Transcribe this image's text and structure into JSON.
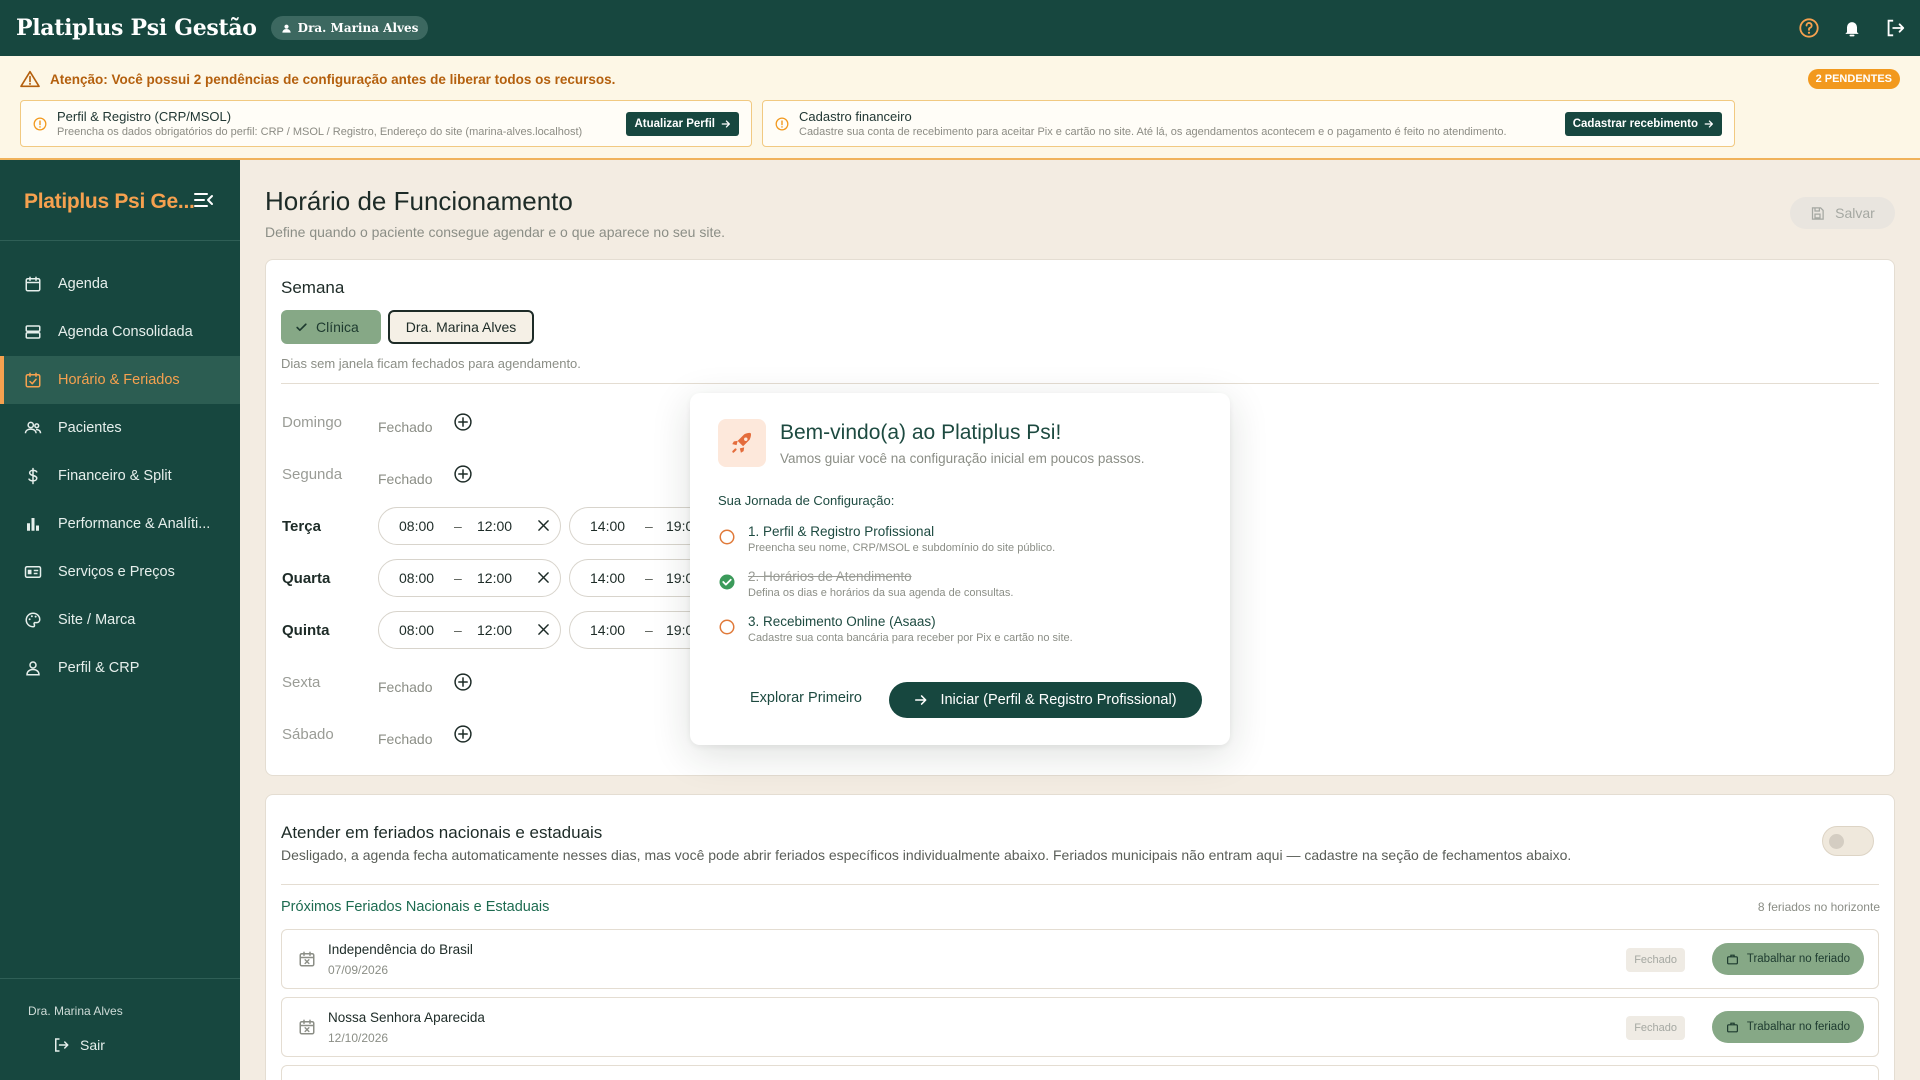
{
  "topbar": {
    "brand": "Platiplus Psi Gestão",
    "user_chip": "Dra. Marina Alves"
  },
  "alert": {
    "message": "Atenção: Você possui 2 pendências de configuração antes de liberar todos os recursos.",
    "badge": "2 PENDENTES",
    "cards": [
      {
        "title": "Perfil & Registro (CRP/MSOL)",
        "desc": "Preencha os dados obrigatórios do perfil: CRP / MSOL / Registro, Endereço do site (marina-alves.localhost)",
        "button": "Atualizar Perfil"
      },
      {
        "title": "Cadastro financeiro",
        "desc": "Cadastre sua conta de recebimento para aceitar Pix e cartão no site. Até lá, os agendamentos acontecem e o pagamento é feito no atendimento.",
        "button": "Cadastrar recebimento"
      }
    ]
  },
  "sidebar": {
    "brand": "Platiplus Psi Ge...",
    "items": [
      {
        "label": "Agenda",
        "icon": "calendar-icon"
      },
      {
        "label": "Agenda Consolidada",
        "icon": "stack-icon"
      },
      {
        "label": "Horário & Feriados",
        "icon": "calendar-check-icon"
      },
      {
        "label": "Pacientes",
        "icon": "users-icon"
      },
      {
        "label": "Financeiro & Split",
        "icon": "dollar-icon"
      },
      {
        "label": "Performance & Analíti...",
        "icon": "bar-chart-icon"
      },
      {
        "label": "Serviços e Preços",
        "icon": "id-card-icon"
      },
      {
        "label": "Site / Marca",
        "icon": "palette-icon"
      },
      {
        "label": "Perfil & CRP",
        "icon": "person-icon"
      }
    ],
    "active_index": 2,
    "footer_user": "Dra. Marina Alves",
    "logout": "Sair"
  },
  "page": {
    "title": "Horário de Funcionamento",
    "subtitle": "Define quando o paciente consegue agendar e o que aparece no seu site.",
    "save": "Salvar"
  },
  "week": {
    "title": "Semana",
    "toggle_clinic": "Clínica",
    "toggle_doctor": "Dra. Marina Alves",
    "hint": "Dias sem janela ficam fechados para agendamento.",
    "closed_label": "Fechado",
    "days": [
      {
        "name": "Domingo",
        "closed": true
      },
      {
        "name": "Segunda",
        "closed": true
      },
      {
        "name": "Terça",
        "closed": false,
        "slot1_start": "08:00",
        "slot1_end": "12:00",
        "slot2_start": "14:00",
        "slot2_end": "19:0"
      },
      {
        "name": "Quarta",
        "closed": false,
        "slot1_start": "08:00",
        "slot1_end": "12:00",
        "slot2_start": "14:00",
        "slot2_end": "19:0"
      },
      {
        "name": "Quinta",
        "closed": false,
        "slot1_start": "08:00",
        "slot1_end": "12:00",
        "slot2_start": "14:00",
        "slot2_end": "19:0"
      },
      {
        "name": "Sexta",
        "closed": true
      },
      {
        "name": "Sábado",
        "closed": true
      }
    ]
  },
  "modal": {
    "title": "Bem-vindo(a) ao Platiplus Psi!",
    "subtitle": "Vamos guiar você na configuração inicial em poucos passos.",
    "journey_label": "Sua Jornada de Configuração:",
    "steps": [
      {
        "title": "1. Perfil & Registro Profissional",
        "desc": "Preencha seu nome, CRP/MSOL e subdomínio do site público.",
        "done": false
      },
      {
        "title": "2. Horários de Atendimento",
        "desc": "Defina os dias e horários da sua agenda de consultas.",
        "done": true
      },
      {
        "title": "3. Recebimento Online (Asaas)",
        "desc": "Cadastre sua conta bancária para receber por Pix e cartão no site.",
        "done": false
      }
    ],
    "explore": "Explorar Primeiro",
    "start": "Iniciar (Perfil & Registro Profissional)"
  },
  "holidays": {
    "title": "Atender em feriados nacionais e estaduais",
    "desc": "Desligado, a agenda fecha automaticamente nesses dias, mas você pode abrir feriados específicos individualmente abaixo. Feriados municipais não entram aqui — cadastre na seção de fechamentos abaixo.",
    "switch_on": false,
    "next_title": "Próximos Feriados Nacionais e Estaduais",
    "count": "8 feriados no horizonte",
    "badge": "Fechado",
    "work_label": "Trabalhar no feriado",
    "items": [
      {
        "name": "Independência do Brasil",
        "date": "07/09/2026"
      },
      {
        "name": "Nossa Senhora Aparecida",
        "date": "12/10/2026"
      }
    ]
  },
  "colors": {
    "primary": "#17473f",
    "accent": "#f6a14f",
    "warning": "#f2991e",
    "sage": "#86a886",
    "background": "#f3ece2"
  }
}
